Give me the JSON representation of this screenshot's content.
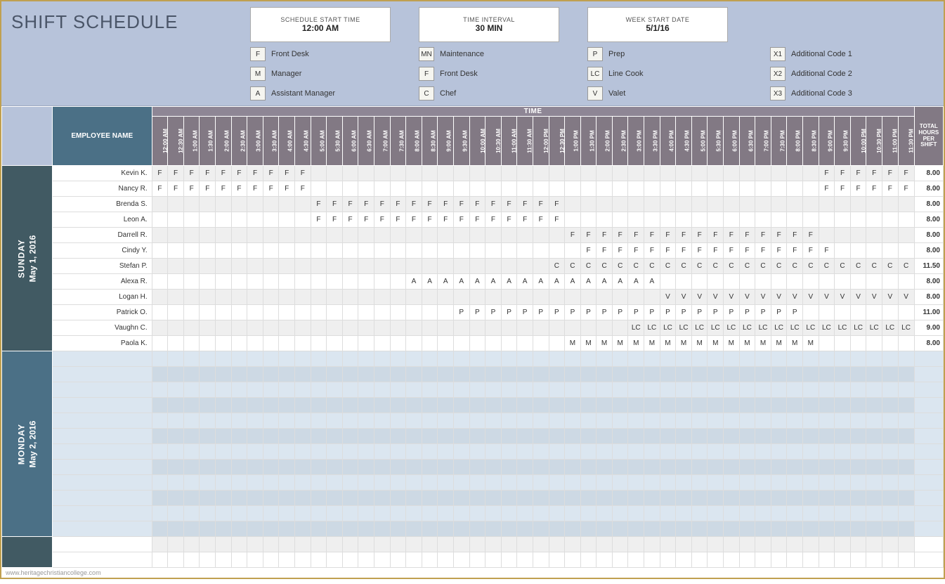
{
  "title": "SHIFT SCHEDULE",
  "params": {
    "start_time": {
      "label": "SCHEDULE START TIME",
      "value": "12:00 AM"
    },
    "interval": {
      "label": "TIME INTERVAL",
      "value": "30 MIN"
    },
    "week_start": {
      "label": "WEEK START DATE",
      "value": "5/1/16"
    }
  },
  "legend": {
    "col1": [
      {
        "code": "F",
        "label": "Front Desk"
      },
      {
        "code": "M",
        "label": "Manager"
      },
      {
        "code": "A",
        "label": "Assistant Manager"
      }
    ],
    "col2": [
      {
        "code": "MN",
        "label": "Maintenance"
      },
      {
        "code": "F",
        "label": "Front Desk"
      },
      {
        "code": "C",
        "label": "Chef"
      }
    ],
    "col3": [
      {
        "code": "P",
        "label": "Prep"
      },
      {
        "code": "LC",
        "label": "Line Cook"
      },
      {
        "code": "V",
        "label": "Valet"
      }
    ],
    "col4": [
      {
        "code": "X1",
        "label": "Additional Code 1"
      },
      {
        "code": "X2",
        "label": "Additional Code 2"
      },
      {
        "code": "X3",
        "label": "Additional Code 3"
      }
    ]
  },
  "columns": {
    "employee": "EMPLOYEE NAME",
    "time_header": "TIME",
    "total": "TOTAL HOURS PER SHIFT"
  },
  "time_slots": [
    "12:00 AM",
    "12:30 AM",
    "1:00 AM",
    "1:30 AM",
    "2:00 AM",
    "2:30 AM",
    "3:00 AM",
    "3:30 AM",
    "4:00 AM",
    "4:30 AM",
    "5:00 AM",
    "5:30 AM",
    "6:00 AM",
    "6:30 AM",
    "7:00 AM",
    "7:30 AM",
    "8:00 AM",
    "8:30 AM",
    "9:00 AM",
    "9:30 AM",
    "10:00 AM",
    "10:30 AM",
    "11:00 AM",
    "11:30 AM",
    "12:00 PM",
    "12:30 PM",
    "1:00 PM",
    "1:30 PM",
    "2:00 PM",
    "2:30 PM",
    "3:00 PM",
    "3:30 PM",
    "4:00 PM",
    "4:30 PM",
    "5:00 PM",
    "5:30 PM",
    "6:00 PM",
    "6:30 PM",
    "7:00 PM",
    "7:30 PM",
    "8:00 PM",
    "8:30 PM",
    "9:00 PM",
    "9:30 PM",
    "10:00 PM",
    "10:30 PM",
    "11:00 PM",
    "11:30 PM"
  ],
  "days": [
    {
      "name": "SUNDAY",
      "date": "May 1, 2016",
      "style": "dark",
      "rows": [
        {
          "employee": "Kevin K.",
          "total": "8.00",
          "shifts": [
            {
              "code": "F",
              "from": 0,
              "to": 9
            },
            {
              "code": "F",
              "from": 42,
              "to": 47
            }
          ]
        },
        {
          "employee": "Nancy R.",
          "total": "8.00",
          "shifts": [
            {
              "code": "F",
              "from": 0,
              "to": 9
            },
            {
              "code": "F",
              "from": 42,
              "to": 47
            }
          ]
        },
        {
          "employee": "Brenda S.",
          "total": "8.00",
          "shifts": [
            {
              "code": "F",
              "from": 10,
              "to": 25
            }
          ]
        },
        {
          "employee": "Leon A.",
          "total": "8.00",
          "shifts": [
            {
              "code": "F",
              "from": 10,
              "to": 25
            }
          ]
        },
        {
          "employee": "Darrell R.",
          "total": "8.00",
          "shifts": [
            {
              "code": "F",
              "from": 26,
              "to": 41
            }
          ]
        },
        {
          "employee": "Cindy Y.",
          "total": "8.00",
          "shifts": [
            {
              "code": "F",
              "from": 27,
              "to": 42
            }
          ]
        },
        {
          "employee": "Stefan P.",
          "total": "11.50",
          "shifts": [
            {
              "code": "C",
              "from": 25,
              "to": 47
            }
          ]
        },
        {
          "employee": "Alexa R.",
          "total": "8.00",
          "shifts": [
            {
              "code": "A",
              "from": 16,
              "to": 31
            }
          ]
        },
        {
          "employee": "Logan H.",
          "total": "8.00",
          "shifts": [
            {
              "code": "V",
              "from": 32,
              "to": 47
            }
          ]
        },
        {
          "employee": "Patrick O.",
          "total": "11.00",
          "shifts": [
            {
              "code": "P",
              "from": 19,
              "to": 40
            }
          ]
        },
        {
          "employee": "Vaughn C.",
          "total": "9.00",
          "shifts": [
            {
              "code": "LC",
              "from": 30,
              "to": 47
            }
          ]
        },
        {
          "employee": "Paola K.",
          "total": "8.00",
          "shifts": [
            {
              "code": "M",
              "from": 26,
              "to": 41
            }
          ]
        }
      ]
    },
    {
      "name": "MONDAY",
      "date": "May 2, 2016",
      "style": "alt",
      "rows": [
        {
          "employee": "",
          "total": "",
          "shifts": []
        },
        {
          "employee": "",
          "total": "",
          "shifts": []
        },
        {
          "employee": "",
          "total": "",
          "shifts": []
        },
        {
          "employee": "",
          "total": "",
          "shifts": []
        },
        {
          "employee": "",
          "total": "",
          "shifts": []
        },
        {
          "employee": "",
          "total": "",
          "shifts": []
        },
        {
          "employee": "",
          "total": "",
          "shifts": []
        },
        {
          "employee": "",
          "total": "",
          "shifts": []
        },
        {
          "employee": "",
          "total": "",
          "shifts": []
        },
        {
          "employee": "",
          "total": "",
          "shifts": []
        },
        {
          "employee": "",
          "total": "",
          "shifts": []
        },
        {
          "employee": "",
          "total": "",
          "shifts": []
        }
      ]
    },
    {
      "name": "",
      "date": "",
      "style": "dark",
      "rows": [
        {
          "employee": "",
          "total": "",
          "shifts": []
        },
        {
          "employee": "",
          "total": "",
          "shifts": []
        }
      ]
    }
  ],
  "watermark": "www.heritagechristiancollege.com"
}
